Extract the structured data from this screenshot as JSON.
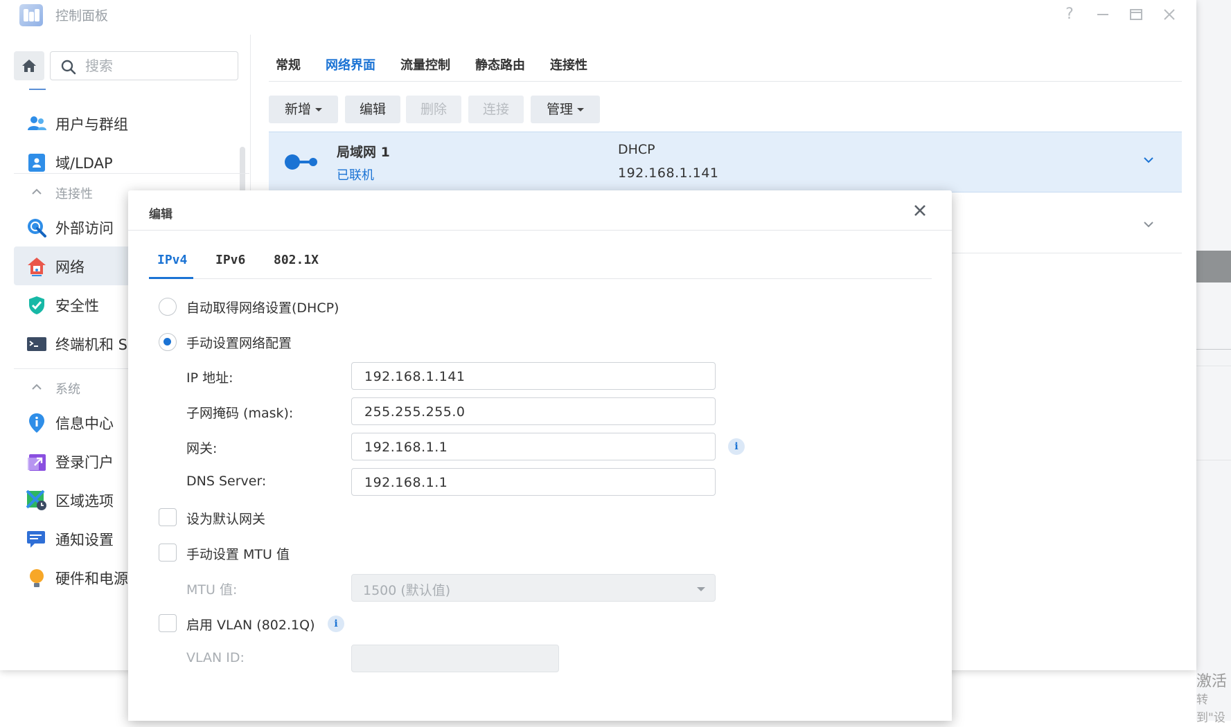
{
  "window": {
    "title": "控制面板"
  },
  "sidebar": {
    "search_placeholder": "搜索",
    "items_top": [
      {
        "label": "用户与群组"
      },
      {
        "label": "域/LDAP"
      }
    ],
    "group_connectivity": "连接性",
    "items_connectivity": [
      {
        "label": "外部访问"
      },
      {
        "label": "网络"
      },
      {
        "label": "安全性"
      },
      {
        "label": "终端机和 S"
      }
    ],
    "group_system": "系统",
    "items_system": [
      {
        "label": "信息中心"
      },
      {
        "label": "登录门户"
      },
      {
        "label": "区域选项"
      },
      {
        "label": "通知设置"
      },
      {
        "label": "硬件和电源"
      }
    ]
  },
  "main": {
    "tabs": [
      {
        "label": "常规"
      },
      {
        "label": "网络界面"
      },
      {
        "label": "流量控制"
      },
      {
        "label": "静态路由"
      },
      {
        "label": "连接性"
      }
    ],
    "toolbar": {
      "add": "新增",
      "edit": "编辑",
      "delete": "删除",
      "connect": "连接",
      "manage": "管理"
    },
    "interfaces": [
      {
        "name": "局域网 1",
        "status": "已联机",
        "mode": "DHCP",
        "ip": "192.168.1.141"
      }
    ]
  },
  "modal": {
    "title": "编辑",
    "tabs": [
      {
        "label": "IPv4"
      },
      {
        "label": "IPv6"
      },
      {
        "label": "802.1X"
      }
    ],
    "option_dhcp": "自动取得网络设置(DHCP)",
    "option_manual": "手动设置网络配置",
    "ip_label": "IP 地址:",
    "ip_value": "192.168.1.141",
    "mask_label": "子网掩码 (mask):",
    "mask_value": "255.255.255.0",
    "gateway_label": "网关:",
    "gateway_value": "192.168.1.1",
    "dns_label": "DNS Server:",
    "dns_value": "192.168.1.1",
    "default_gateway_label": "设为默认网关",
    "mtu_manual_label": "手动设置 MTU 值",
    "mtu_label": "MTU 值:",
    "mtu_value": "1500 (默认值)",
    "vlan_label": "启用 VLAN (802.1Q)",
    "vlan_id_label": "VLAN ID:",
    "info_glyph": "i"
  },
  "watermark": {
    "line1": "激活",
    "line2": "转到\"设"
  },
  "colors": {
    "accent": "#1b73d4",
    "selected_row": "#e3eefa",
    "sidebar_active": "#e8edf3"
  }
}
